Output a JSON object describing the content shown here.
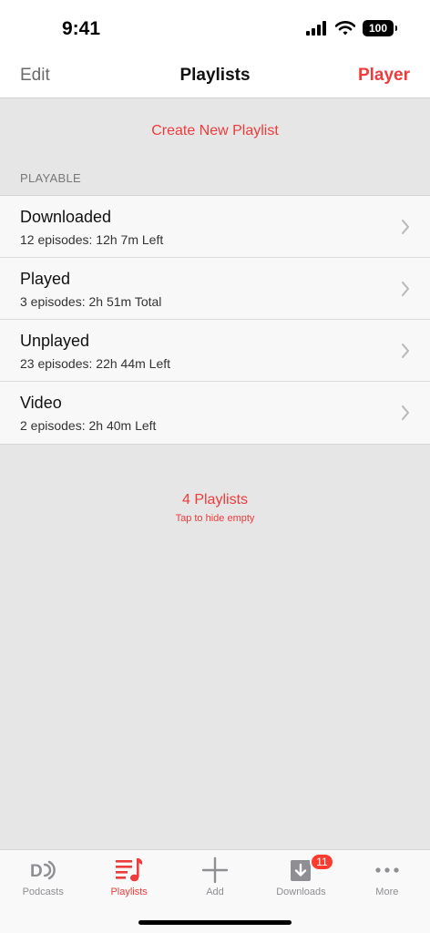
{
  "status_bar": {
    "time": "9:41",
    "battery": "100"
  },
  "nav": {
    "edit_label": "Edit",
    "title": "Playlists",
    "player_label": "Player"
  },
  "create_playlist_label": "Create New Playlist",
  "section_header": "PLAYABLE",
  "playlists": [
    {
      "title": "Downloaded",
      "subtitle": "12 episodes: 12h 7m Left"
    },
    {
      "title": "Played",
      "subtitle": "3 episodes: 2h 51m Total"
    },
    {
      "title": "Unplayed",
      "subtitle": "23 episodes: 22h 44m Left"
    },
    {
      "title": "Video",
      "subtitle": "2 episodes: 2h 40m Left"
    }
  ],
  "summary": {
    "count": "4 Playlists",
    "hint": "Tap to hide empty"
  },
  "tabs": [
    {
      "label": "Podcasts",
      "icon": "podcasts-icon"
    },
    {
      "label": "Playlists",
      "icon": "playlists-icon",
      "active": true
    },
    {
      "label": "Add",
      "icon": "plus-icon"
    },
    {
      "label": "Downloads",
      "icon": "download-icon",
      "badge": "11"
    },
    {
      "label": "More",
      "icon": "more-icon"
    }
  ],
  "colors": {
    "accent": "#ee3b3b",
    "badge": "#ff3b30",
    "background": "#e6e6e6"
  }
}
